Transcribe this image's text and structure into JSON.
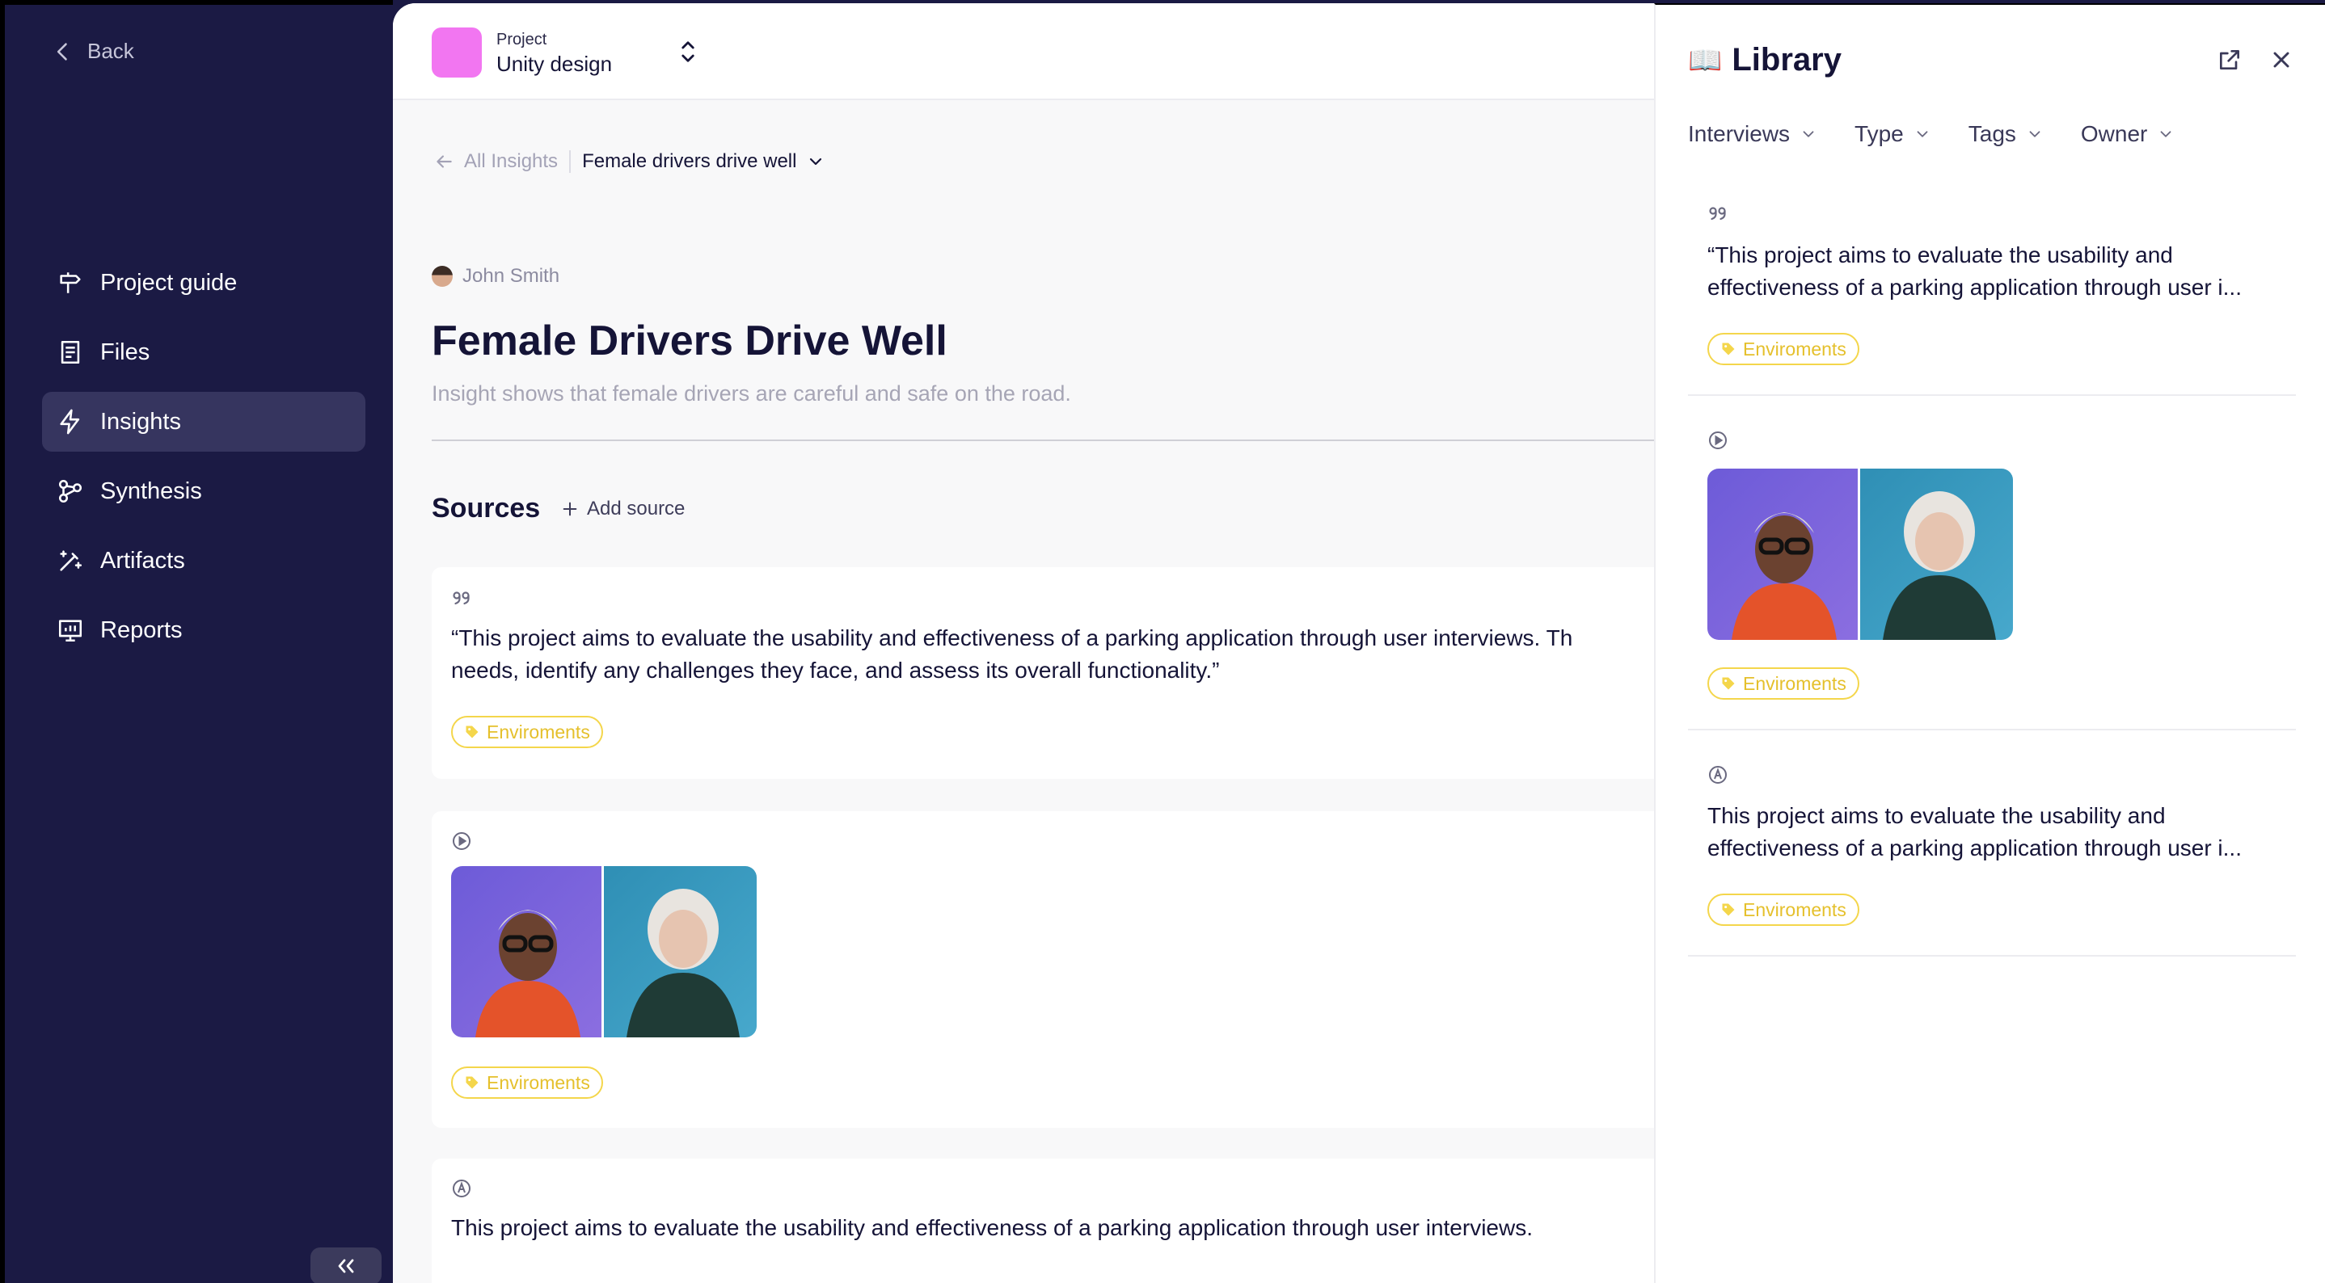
{
  "sidebar": {
    "back_label": "Back",
    "items": [
      {
        "label": "Project guide",
        "icon": "signpost-icon"
      },
      {
        "label": "Files",
        "icon": "file-icon"
      },
      {
        "label": "Insights",
        "icon": "lightning-icon",
        "active": true
      },
      {
        "label": "Synthesis",
        "icon": "synthesis-icon"
      },
      {
        "label": "Artifacts",
        "icon": "magic-wand-icon"
      },
      {
        "label": "Reports",
        "icon": "report-icon"
      }
    ]
  },
  "topbar": {
    "project_label": "Project",
    "project_name": "Unity design",
    "project_color": "#f276f1"
  },
  "breadcrumb": {
    "back_label": "All Insights",
    "current": "Female drivers drive well"
  },
  "insight": {
    "author": "John Smith",
    "title": "Female Drivers Drive Well",
    "subtitle": "Insight shows that female drivers are careful and safe on the road."
  },
  "sources": {
    "heading": "Sources",
    "add_label": "Add source",
    "cards": [
      {
        "type": "quote",
        "line1": "“This project aims to evaluate the usability and effectiveness of a parking application through user interviews. Th",
        "line2": "needs, identify any challenges they face, and assess its overall functionality.”",
        "tag": "Enviroments"
      },
      {
        "type": "video",
        "tag": "Enviroments"
      },
      {
        "type": "ai-note",
        "line1": "This project aims to evaluate the usability and effectiveness of a parking application through user interviews."
      }
    ]
  },
  "library": {
    "title": "Library",
    "filters": [
      "Interviews",
      "Type",
      "Tags",
      "Owner"
    ],
    "items": [
      {
        "type": "quote",
        "line1": "“This project aims to evaluate the usability and",
        "line2": "effectiveness of a parking application through user i...",
        "tag": "Enviroments"
      },
      {
        "type": "video",
        "tag": "Enviroments"
      },
      {
        "type": "ai-note",
        "line1": "This project aims to evaluate the usability and",
        "line2": "effectiveness of a parking application through user i...",
        "tag": "Enviroments"
      }
    ]
  },
  "colors": {
    "sidebar_bg": "#1b1a44",
    "tag": "#f4d64b"
  }
}
